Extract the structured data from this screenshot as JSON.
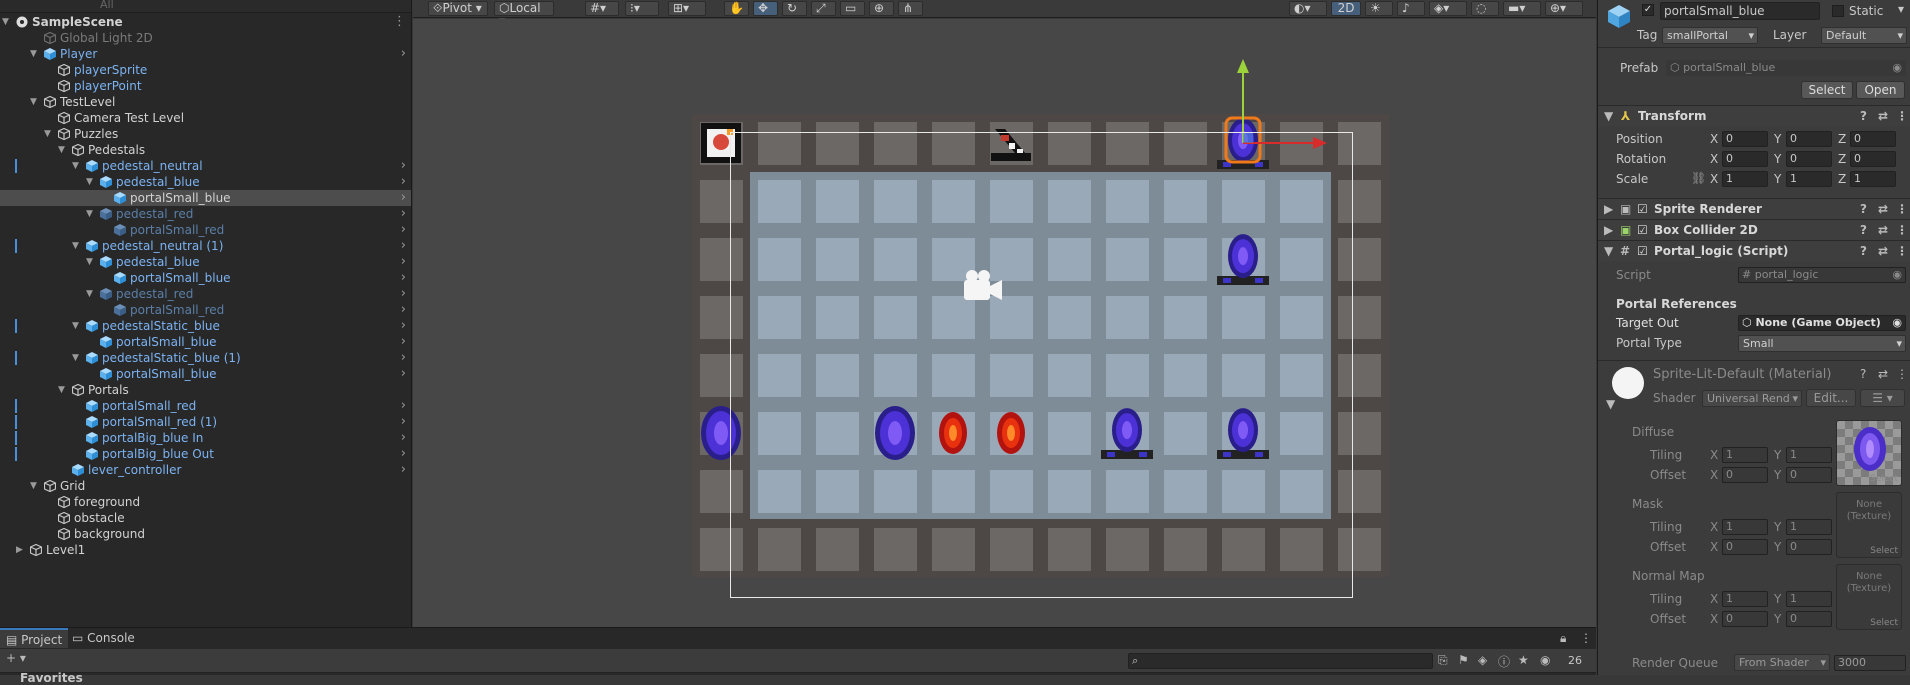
{
  "hierarchy": {
    "search_placeholder": "All",
    "rows": [
      {
        "label": "SampleScene",
        "depth": 0,
        "arrow": "▼",
        "icon": "unity-icon",
        "color": "t-white",
        "bold": true,
        "menu": "⋮"
      },
      {
        "label": "Global Light 2D",
        "depth": 2,
        "arrow": "",
        "icon": "gameobject-icon",
        "color": "t-dim"
      },
      {
        "label": "Player",
        "depth": 2,
        "arrow": "▼",
        "icon": "prefab-icon",
        "color": "t-blue",
        "chev": true
      },
      {
        "label": "playerSprite",
        "depth": 3,
        "arrow": "",
        "icon": "gameobject-icon",
        "color": "t-blue"
      },
      {
        "label": "playerPoint",
        "depth": 3,
        "arrow": "",
        "icon": "gameobject-icon",
        "color": "t-blue"
      },
      {
        "label": "TestLevel",
        "depth": 2,
        "arrow": "▼",
        "icon": "gameobject-icon",
        "color": "t-white"
      },
      {
        "label": "Camera Test Level",
        "depth": 3,
        "arrow": "",
        "icon": "gameobject-icon",
        "color": "t-white"
      },
      {
        "label": "Puzzles",
        "depth": 3,
        "arrow": "▼",
        "icon": "gameobject-icon",
        "color": "t-white"
      },
      {
        "label": "Pedestals",
        "depth": 4,
        "arrow": "▼",
        "icon": "gameobject-icon",
        "color": "t-white"
      },
      {
        "label": "pedestal_neutral",
        "depth": 5,
        "arrow": "▼",
        "icon": "prefab-icon",
        "color": "t-blue",
        "chev": true,
        "mark": true
      },
      {
        "label": "pedestal_blue",
        "depth": 6,
        "arrow": "▼",
        "icon": "prefab-icon",
        "color": "t-blue",
        "chev": true
      },
      {
        "label": "portalSmall_blue",
        "depth": 7,
        "arrow": "",
        "icon": "prefab-icon",
        "color": "t-white",
        "chev": true,
        "sel": true
      },
      {
        "label": "pedestal_red",
        "depth": 6,
        "arrow": "▼",
        "icon": "prefab-icon",
        "color": "t-dimblue",
        "chev": true
      },
      {
        "label": "portalSmall_red",
        "depth": 7,
        "arrow": "",
        "icon": "prefab-icon",
        "color": "t-dimblue",
        "chev": true
      },
      {
        "label": "pedestal_neutral (1)",
        "depth": 5,
        "arrow": "▼",
        "icon": "prefab-icon",
        "color": "t-blue",
        "chev": true,
        "mark": true
      },
      {
        "label": "pedestal_blue",
        "depth": 6,
        "arrow": "▼",
        "icon": "prefab-icon",
        "color": "t-blue",
        "chev": true
      },
      {
        "label": "portalSmall_blue",
        "depth": 7,
        "arrow": "",
        "icon": "prefab-icon",
        "color": "t-blue",
        "chev": true
      },
      {
        "label": "pedestal_red",
        "depth": 6,
        "arrow": "▼",
        "icon": "prefab-icon",
        "color": "t-dimblue",
        "chev": true
      },
      {
        "label": "portalSmall_red",
        "depth": 7,
        "arrow": "",
        "icon": "prefab-icon",
        "color": "t-dimblue",
        "chev": true
      },
      {
        "label": "pedestalStatic_blue",
        "depth": 5,
        "arrow": "▼",
        "icon": "prefab-icon",
        "color": "t-blue",
        "chev": true,
        "mark": true
      },
      {
        "label": "portalSmall_blue",
        "depth": 6,
        "arrow": "",
        "icon": "prefab-icon",
        "color": "t-blue",
        "chev": true
      },
      {
        "label": "pedestalStatic_blue (1)",
        "depth": 5,
        "arrow": "▼",
        "icon": "prefab-icon",
        "color": "t-blue",
        "chev": true,
        "mark": true
      },
      {
        "label": "portalSmall_blue",
        "depth": 6,
        "arrow": "",
        "icon": "prefab-icon",
        "color": "t-blue",
        "chev": true
      },
      {
        "label": "Portals",
        "depth": 4,
        "arrow": "▼",
        "icon": "gameobject-icon",
        "color": "t-white"
      },
      {
        "label": "portalSmall_red",
        "depth": 5,
        "arrow": "",
        "icon": "prefab-icon",
        "color": "t-blue",
        "chev": true,
        "mark": true
      },
      {
        "label": "portalSmall_red (1)",
        "depth": 5,
        "arrow": "",
        "icon": "prefab-icon",
        "color": "t-blue",
        "chev": true,
        "mark": true
      },
      {
        "label": "portalBig_blue In",
        "depth": 5,
        "arrow": "",
        "icon": "prefab-icon",
        "color": "t-blue",
        "chev": true,
        "mark": true
      },
      {
        "label": "portalBig_blue Out",
        "depth": 5,
        "arrow": "",
        "icon": "prefab-icon",
        "color": "t-blue",
        "chev": true,
        "mark": true
      },
      {
        "label": "lever_controller",
        "depth": 4,
        "arrow": "",
        "icon": "prefab-icon",
        "color": "t-blue",
        "chev": true
      },
      {
        "label": "Grid",
        "depth": 2,
        "arrow": "▼",
        "icon": "gameobject-icon",
        "color": "t-white"
      },
      {
        "label": "foreground",
        "depth": 3,
        "arrow": "",
        "icon": "gameobject-icon",
        "color": "t-white"
      },
      {
        "label": "obstacle",
        "depth": 3,
        "arrow": "",
        "icon": "gameobject-icon",
        "color": "t-white"
      },
      {
        "label": "background",
        "depth": 3,
        "arrow": "",
        "icon": "gameobject-icon",
        "color": "t-white"
      },
      {
        "label": "Level1",
        "depth": 1,
        "arrow": "▶",
        "icon": "gameobject-icon",
        "color": "t-white"
      }
    ]
  },
  "scene_toolbar": {
    "pivot": "Pivot",
    "local": "Local",
    "mode_2d": "2D"
  },
  "inspector": {
    "object_name": "portalSmall_blue",
    "static_label": "Static",
    "tag_label": "Tag",
    "tag_value": "smallPortal",
    "layer_label": "Layer",
    "layer_value": "Default",
    "prefab_label": "Prefab",
    "prefab_value": "portalSmall_blue",
    "select_btn": "Select",
    "open_btn": "Open",
    "transform": {
      "title": "Transform",
      "position_label": "Position",
      "rotation_label": "Rotation",
      "scale_label": "Scale",
      "position": [
        "0",
        "0",
        "0"
      ],
      "rotation": [
        "0",
        "0",
        "0"
      ],
      "scale": [
        "1",
        "1",
        "1"
      ]
    },
    "sprite_renderer": "Sprite Renderer",
    "box_collider": "Box Collider 2D",
    "portal_logic": "Portal_logic (Script)",
    "script_label": "Script",
    "script_value": "portal_logic",
    "portal_refs": "Portal References",
    "target_out_label": "Target Out",
    "target_out_value": "None (Game Object)",
    "portal_type_label": "Portal Type",
    "portal_type_value": "Small",
    "material_name": "Sprite-Lit-Default (Material)",
    "shader_label": "Shader",
    "shader_value": "Universal Rend",
    "edit_btn": "Edit...",
    "diffuse": "Diffuse",
    "mask": "Mask",
    "normal_map": "Normal Map",
    "tiling": "Tiling",
    "offset": "Offset",
    "tiling_vals": [
      "1",
      "1"
    ],
    "offset_vals": [
      "0",
      "0"
    ],
    "none_texture": "None (Texture)",
    "select_small": "Select",
    "render_queue_label": "Render Queue",
    "render_queue_mode": "From Shader",
    "render_queue_value": "3000"
  },
  "bottom": {
    "project_tab": "Project",
    "console_tab": "Console",
    "favorites": "Favorites",
    "count": "26"
  },
  "colors": {
    "accent": "#46607c",
    "selection": "#4d4d4d",
    "prefab_blue": "#7cb3f2"
  }
}
